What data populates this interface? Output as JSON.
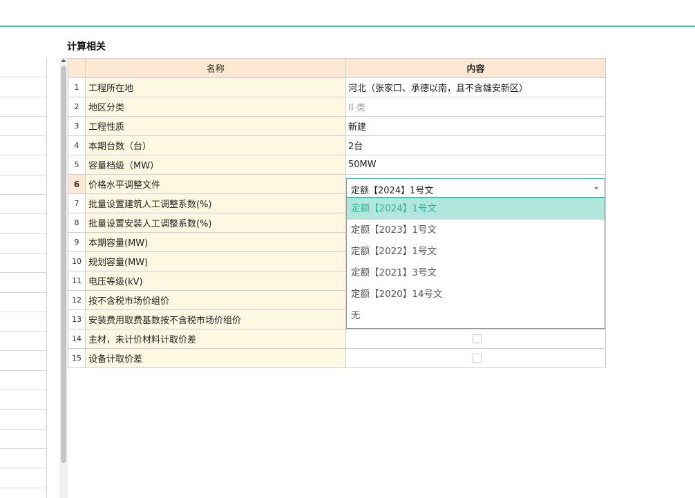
{
  "section_title": "计算相关",
  "table": {
    "header": {
      "name": "名称",
      "content": "内容"
    },
    "active_row": 6,
    "rows": [
      {
        "idx": "1",
        "name": "工程所在地",
        "value": "河北（张家口、承德以南，且不含雄安新区）"
      },
      {
        "idx": "2",
        "name": "地区分类",
        "value": "II 类"
      },
      {
        "idx": "3",
        "name": "工程性质",
        "value": "新建"
      },
      {
        "idx": "4",
        "name": "本期台数（台）",
        "value": "2台"
      },
      {
        "idx": "5",
        "name": "容量档级（MW）",
        "value": "50MW"
      },
      {
        "idx": "6",
        "name": "价格水平调整文件",
        "value": ""
      },
      {
        "idx": "7",
        "name": "批量设置建筑人工调整系数(%)",
        "value": ""
      },
      {
        "idx": "8",
        "name": "批量设置安装人工调整系数(%)",
        "value": ""
      },
      {
        "idx": "9",
        "name": "本期容量(MW)",
        "value": ""
      },
      {
        "idx": "10",
        "name": "规划容量(MW)",
        "value": ""
      },
      {
        "idx": "11",
        "name": "电压等级(kV)",
        "value": ""
      },
      {
        "idx": "12",
        "name": "按不含税市场价组价",
        "value": ""
      },
      {
        "idx": "13",
        "name": "安装费用取费基数按不含税市场价组价",
        "value": ""
      },
      {
        "idx": "14",
        "name": "主材，未计价材料计取价差",
        "value": ""
      },
      {
        "idx": "15",
        "name": "设备计取价差",
        "value": ""
      }
    ]
  },
  "price_file_select": {
    "selected": "定额【2024】1号文",
    "options": [
      "定额【2024】1号文",
      "定额【2023】1号文",
      "定额【2022】1号文",
      "定额【2021】3号文",
      "定额【2020】14号文",
      "无"
    ],
    "highlighted_index": 0
  },
  "colors": {
    "accent": "#3cc2a9",
    "header_bg": "#fde9d3",
    "name_bg": "#fdf8e1",
    "option_highlight_bg": "#b3e7dd",
    "option_highlight_text": "#2bb497"
  }
}
